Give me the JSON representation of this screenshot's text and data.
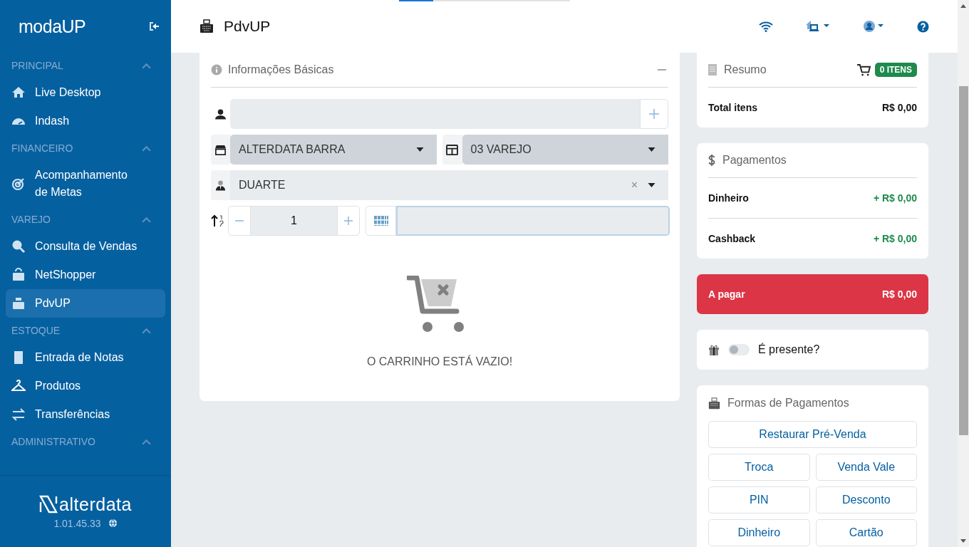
{
  "sidebar": {
    "logo": "modaUP",
    "sections": [
      {
        "title": "PRINCIPAL",
        "expanded": true,
        "items": [
          {
            "kind": "home",
            "label": "Live Desktop",
            "selected": false
          },
          {
            "kind": "gauge",
            "label": "Indash",
            "selected": false
          }
        ]
      },
      {
        "title": "FINANCEIRO",
        "expanded": true,
        "items": [
          {
            "kind": "target",
            "label": "Acompanhamento de Metas",
            "selected": false
          }
        ]
      },
      {
        "title": "VAREJO",
        "expanded": true,
        "items": [
          {
            "kind": "search",
            "label": "Consulta de Vendas",
            "selected": false
          },
          {
            "kind": "bag",
            "label": "NetShopper",
            "selected": false
          },
          {
            "kind": "register",
            "label": "PdvUP",
            "selected": true
          }
        ]
      },
      {
        "title": "ESTOQUE",
        "expanded": true,
        "items": [
          {
            "kind": "receipt",
            "label": "Entrada de Notas",
            "selected": false
          },
          {
            "kind": "hanger",
            "label": "Produtos",
            "selected": false
          },
          {
            "kind": "transfer",
            "label": "Transferências",
            "selected": false
          }
        ]
      },
      {
        "title": "ADMINISTRATIVO",
        "expanded": true
      }
    ],
    "footer": {
      "brand": "alterdata",
      "version": "1.01.45.33"
    }
  },
  "header": {
    "title": "PdvUP",
    "loading_bar": {
      "level": 0.2
    }
  },
  "basic_info": {
    "title": "Informações Básicas",
    "expanded": true,
    "store": {
      "value": "ALTERDATA BARRA"
    },
    "price_table": {
      "value": "03 VAREJO"
    },
    "seller": {
      "value": "DUARTE",
      "clear": "×"
    },
    "quantity": {
      "value": "1"
    },
    "barcode": {
      "focused": true
    },
    "empty_message": "O CARRINHO ESTÁ VAZIO!"
  },
  "summary": {
    "title": "Resumo",
    "badge": "0 ITENS",
    "rows": [
      {
        "label": "Total itens",
        "value": "R$ 0,00"
      }
    ]
  },
  "payments": {
    "title": "Pagamentos",
    "rows": [
      {
        "label": "Dinheiro",
        "value": "+ R$ 0,00"
      },
      {
        "label": "Cashback",
        "value": "+ R$ 0,00"
      }
    ]
  },
  "to_pay": {
    "label": "A pagar",
    "value": "R$ 0,00"
  },
  "gift": {
    "label": "É presente?",
    "on": false
  },
  "payment_methods": {
    "title": "Formas de Pagamentos",
    "buttons": [
      {
        "label": "Restaurar Pré-Venda",
        "kind": "wide"
      },
      {
        "label": "Troca",
        "kind": "half"
      },
      {
        "label": "Venda Vale",
        "kind": "half"
      },
      {
        "label": "PIN",
        "kind": "half"
      },
      {
        "label": "Desconto",
        "kind": "half"
      },
      {
        "label": "Dinheiro",
        "kind": "half"
      },
      {
        "label": "Cartão",
        "kind": "half"
      }
    ]
  }
}
